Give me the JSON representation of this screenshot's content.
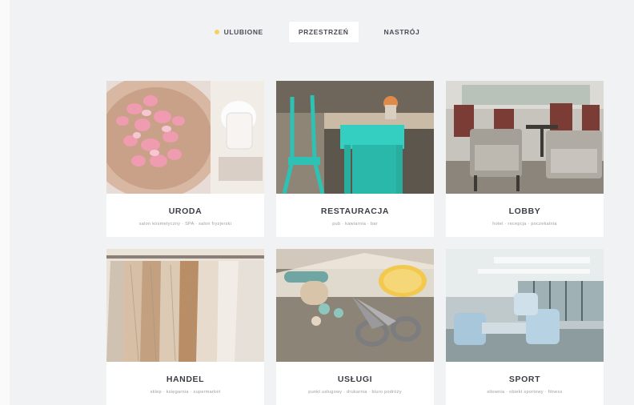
{
  "tabs": [
    {
      "label": "ULUBIONE",
      "icon": "star-icon",
      "active": false
    },
    {
      "label": "PRZESTRZEŃ",
      "active": true
    },
    {
      "label": "NASTRÓJ",
      "active": false
    }
  ],
  "cards": [
    {
      "title": "URODA",
      "subtitle": "salon kosmetyczny · SPA · salon fryzjerski"
    },
    {
      "title": "RESTAURACJA",
      "subtitle": "pub · kawiarnia · bar"
    },
    {
      "title": "LOBBY",
      "subtitle": "hotel · recepcja · poczekalnia"
    },
    {
      "title": "HANDEL",
      "subtitle": "sklep · księgarnia · supermarket"
    },
    {
      "title": "USŁUGI",
      "subtitle": "punkt usługowy · drukarnia · biuro podróży"
    },
    {
      "title": "SPORT",
      "subtitle": "siłownia · obiekt sportowy · fitness"
    }
  ],
  "colors": {
    "accent_star": "#f4d25d",
    "background": "#f1f2f4",
    "card": "#ffffff"
  }
}
